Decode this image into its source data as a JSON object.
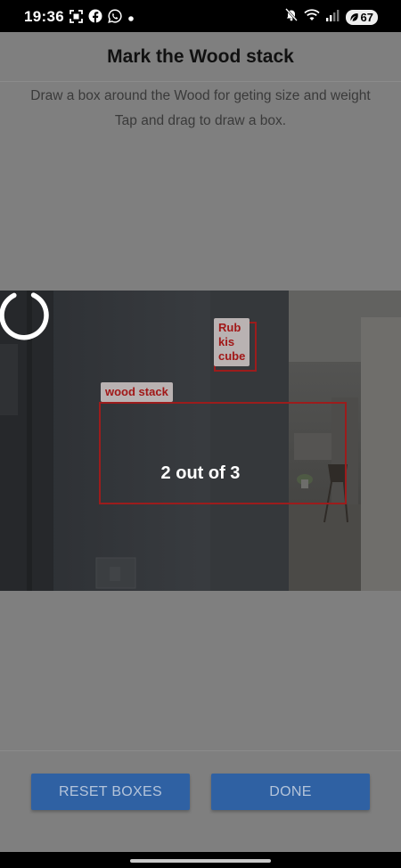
{
  "status_bar": {
    "time": "19:36",
    "left_icons": [
      "screenshot-icon",
      "facebook-icon",
      "whatsapp-icon",
      "dot-icon"
    ],
    "right_icons": [
      "mute-icon",
      "wifi-icon",
      "signal-icon"
    ],
    "battery": "67"
  },
  "header": {
    "title": "Mark the Wood stack"
  },
  "instructions": {
    "line1": "Draw a box around the Wood for geting size and weight",
    "line2": "Tap and drag to draw a box."
  },
  "boxes": [
    {
      "label_lines": [
        "wood stack"
      ],
      "color": "#9c1c1c"
    },
    {
      "label_lines": [
        "Rub",
        "kis",
        "cube"
      ],
      "color": "#9c1c1c"
    }
  ],
  "loading": {
    "progress_text": "2 out of 3",
    "current": 2,
    "total": 3
  },
  "buttons": {
    "reset": "RESET BOXES",
    "done": "DONE"
  },
  "colors": {
    "primary_button": "#2f61a3",
    "box_stroke": "#9c1c1c",
    "overlay": "#7f7f7f"
  }
}
